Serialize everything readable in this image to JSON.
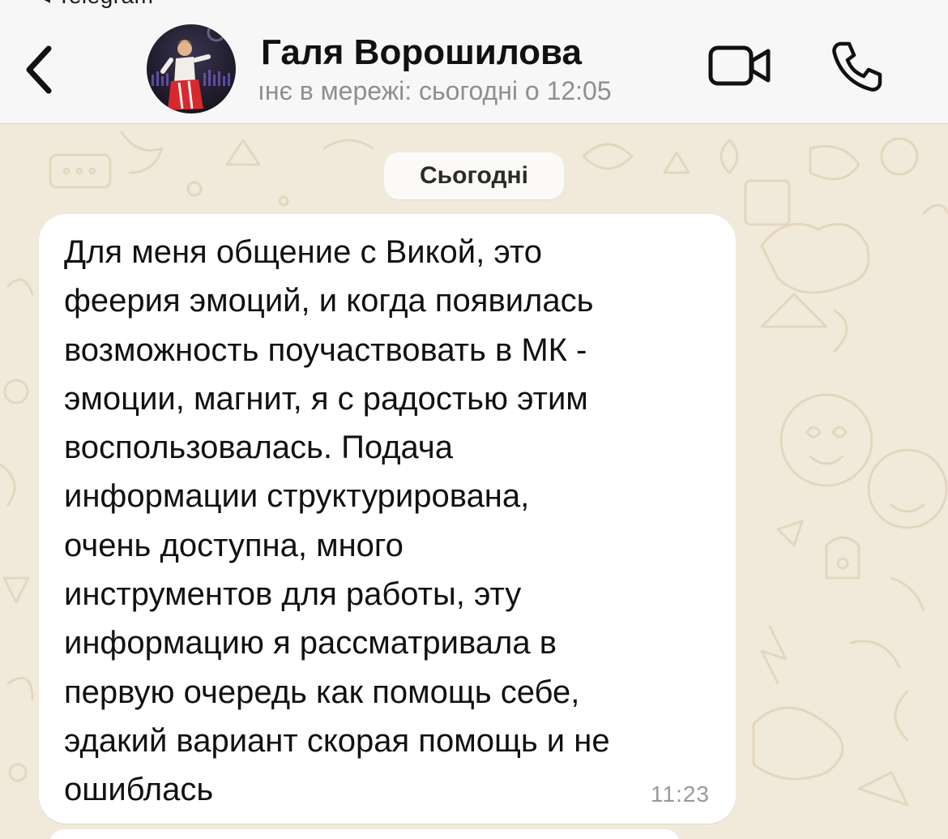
{
  "status_bar": {
    "back_app": "◂ Telegram"
  },
  "header": {
    "back_icon": "chevron-left-icon",
    "contact_name": "Галя Ворошилова",
    "contact_status": "ıнє в мережі: сьогодні о 12:05",
    "video_icon": "video-camera-icon",
    "call_icon": "phone-icon"
  },
  "chat": {
    "date_label": "Сьогодні",
    "messages": [
      {
        "text": "Для меня общение с Викой, это\nфеерия эмоций, и когда появилась\nвозможность поучаствовать в МК -\nэмоции, магнит, я с радостью этим\nвоспользовалась. Подача\nинформации структурирована,\nочень доступна, много\nинструментов для работы, эту\nинформацию я рассматривала в\nпервую очередь как помощь себе,\nэдакий вариант скорая помощь и не\nошиблась",
        "time": "11:23"
      }
    ]
  },
  "colors": {
    "header_bg": "#f7f7f7",
    "chat_bg": "#f1eadb",
    "bubble_bg": "#ffffff",
    "meta_gray": "#8e8e93"
  }
}
